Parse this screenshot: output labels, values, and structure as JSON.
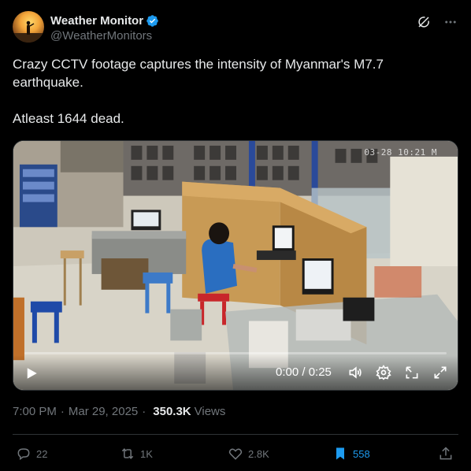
{
  "post": {
    "author_name": "Weather Monitor",
    "author_handle": "@WeatherMonitors",
    "text_line_1": "Crazy CCTV footage captures the intensity of Myanmar's M7.7 earthquake.",
    "text_line_2": "Atleast 1644 dead.",
    "time": "7:00 PM",
    "date": "Mar 29, 2025",
    "views_count": "350.3K",
    "views_label": "Views"
  },
  "video": {
    "time_display": "0:00 / 0:25",
    "progress_fraction": 0.0,
    "overlay_timestamp": "03-28 10:21 M"
  },
  "actions": {
    "replies": "22",
    "reposts": "1K",
    "likes": "2.8K",
    "bookmarks": "558"
  },
  "colors": {
    "background": "#000000",
    "text": "#e7e9ea",
    "muted": "#71767b",
    "accent": "#1d9bf0",
    "divider": "#2f3336"
  },
  "icons": [
    "verified-badge-icon",
    "grok-icon",
    "more-icon",
    "play-icon",
    "volume-icon",
    "settings-icon",
    "pip-icon",
    "fullscreen-icon",
    "reply-icon",
    "repost-icon",
    "like-icon",
    "bookmark-icon",
    "share-icon"
  ]
}
